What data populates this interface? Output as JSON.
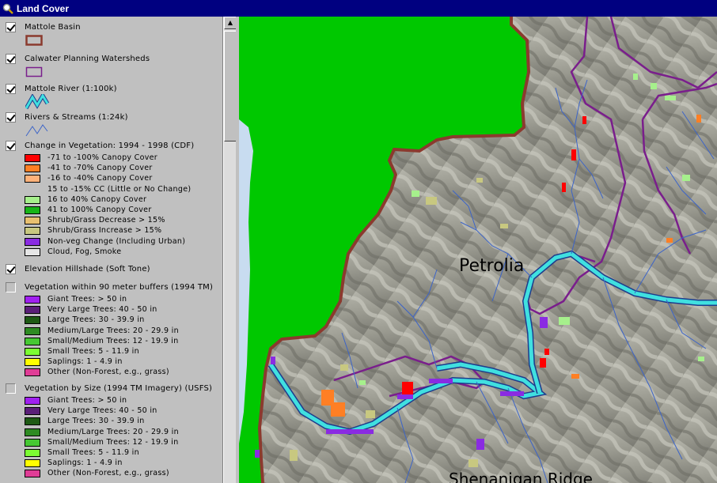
{
  "window": {
    "title": "Land Cover"
  },
  "layers": [
    {
      "name": "Mattole Basin",
      "checked": true
    },
    {
      "name": "Calwater Planning Watersheds",
      "checked": true
    },
    {
      "name": "Mattole River (1:100k)",
      "checked": true
    },
    {
      "name": "Rivers & Streams (1:24k)",
      "checked": true
    },
    {
      "name": "Change in Vegetation: 1994 - 1998 (CDF)",
      "checked": true,
      "classes": [
        {
          "label": "-71 to -100% Canopy Cover",
          "color": "#ff0000"
        },
        {
          "label": "-41 to -70% Canopy Cover",
          "color": "#ff7f24"
        },
        {
          "label": "-16 to -40% Canopy Cover",
          "color": "#ffb27a"
        },
        {
          "label": "15 to -15% CC (Little or No Change)",
          "color": ""
        },
        {
          "label": "16 to 40% Canopy Cover",
          "color": "#a6f08c"
        },
        {
          "label": "41 to 100% Canopy Cover",
          "color": "#18b418"
        },
        {
          "label": "Shrub/Grass Decrease > 15%",
          "color": "#e8c070"
        },
        {
          "label": "Shrub/Grass Increase > 15%",
          "color": "#c8c880"
        },
        {
          "label": "Non-veg Change (Including Urban)",
          "color": "#8a2be2"
        },
        {
          "label": "Cloud, Fog, Smoke",
          "color": "#e6e6e6"
        }
      ]
    },
    {
      "name": "Elevation Hillshade (Soft Tone)",
      "checked": true
    },
    {
      "name": "Vegetation within 90 meter buffers (1994 TM)",
      "checked": false,
      "classes": [
        {
          "label": "Giant Trees: > 50 in",
          "color": "#a020f0"
        },
        {
          "label": "Very Large Trees: 40 - 50 in",
          "color": "#5a1e78"
        },
        {
          "label": "Large Trees: 30 - 39.9 in",
          "color": "#1e5a14"
        },
        {
          "label": "Medium/Large Trees: 20 - 29.9 in",
          "color": "#2e8b22"
        },
        {
          "label": "Small/Medium Trees: 12 - 19.9 in",
          "color": "#46c832"
        },
        {
          "label": "Small Trees: 5 - 11.9 in",
          "color": "#7cfc32"
        },
        {
          "label": "Saplings: 1 - 4.9 in",
          "color": "#ffff00"
        },
        {
          "label": "Other (Non-Forest, e.g., grass)",
          "color": "#e03c96"
        }
      ]
    },
    {
      "name": "Vegetation by Size (1994 TM Imagery) (USFS)",
      "checked": false,
      "classes": [
        {
          "label": "Giant Trees: > 50 in",
          "color": "#a020f0"
        },
        {
          "label": "Very Large Trees: 40 - 50 in",
          "color": "#5a1e78"
        },
        {
          "label": "Large Trees: 30 - 39.9 in",
          "color": "#1e5a14"
        },
        {
          "label": "Medium/Large Trees: 20 - 29.9 in",
          "color": "#2e8b22"
        },
        {
          "label": "Small/Medium Trees: 12 - 19.9 in",
          "color": "#46c832"
        },
        {
          "label": "Small Trees: 5 - 11.9 in",
          "color": "#7cfc32"
        },
        {
          "label": "Saplings: 1 - 4.9 in",
          "color": "#ffff00"
        },
        {
          "label": "Other (Non-Forest, e.g., grass)",
          "color": "#e03c96"
        }
      ]
    }
  ],
  "map": {
    "labels": {
      "town": "Petrolia",
      "ridge": "Shenanigan Ridge"
    }
  },
  "colors": {
    "title_bar": "#000080",
    "ocean": "#c8dcf0",
    "land_mask": "#00c800",
    "basin_outline": "#8b3a2e",
    "watershed_outline": "#7a1e8c",
    "river_fill": "#40e0e0",
    "streams": "#3c64c8",
    "hillshade": "#9a9a90"
  }
}
